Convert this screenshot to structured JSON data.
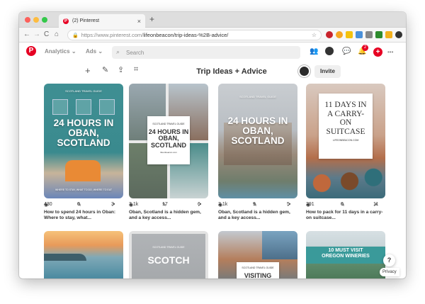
{
  "browser": {
    "tab_title": "(2) Pinterest",
    "tab_favicon": "P",
    "tab_close": "×",
    "new_tab": "+",
    "url_host": "https://www.pinterest.com/",
    "url_path": "lifeonbeacon/trip-ideas-%2B-advice/",
    "nav_icons": {
      "back": "←",
      "forward": "→",
      "reload": "C",
      "home": "⌂",
      "lock": "🔒",
      "star": "☆"
    }
  },
  "header": {
    "logo": "P",
    "analytics_label": "Analytics",
    "ads_label": "Ads",
    "chevron": "⌄",
    "search_placeholder": "Search",
    "notification_count": "2",
    "add": "+",
    "more": "•••"
  },
  "board": {
    "title": "Trip Ideas + Advice",
    "invite_label": "Invite",
    "tools": {
      "add": "+",
      "edit": "✎",
      "share": "⇪",
      "organize": "⌗"
    }
  },
  "pins": [
    {
      "title_lines": [
        "24 HOURS IN",
        "OBAN,",
        "SCOTLAND"
      ],
      "small_label": "SCOTLAND TRAVEL GUIDE",
      "footer": "WHERE TO STAY, WHAT TO DO, WHERE TO EAT",
      "saves": "430",
      "repins": "0",
      "clicks": "3",
      "description": "How to spend 24 hours in Oban: Where to stay, what..."
    },
    {
      "title_lines": [
        "24 HOURS IN",
        "OBAN,",
        "SCOTLAND"
      ],
      "small_label": "SCOTLAND TRAVEL GUIDE",
      "footer": "lifeonbeacon.com",
      "saves": "3.1k",
      "repins": "17",
      "clicks": "6",
      "description": "Oban, Scotland is a hidden gem, and a key access..."
    },
    {
      "title_lines": [
        "24 HOURS IN",
        "OBAN,",
        "SCOTLAND"
      ],
      "small_label": "SCOTLAND TRAVEL GUIDE",
      "footer": "",
      "saves": "2.1k",
      "repins": "9",
      "clicks": "5",
      "description": "Oban, Scotland is a hidden gem, and a key access..."
    },
    {
      "title_lines": [
        "11 DAYS IN",
        "A CARRY-",
        "ON",
        "SUITCASE"
      ],
      "small_label": "",
      "footer": "LIFEONBEACON.COM",
      "saves": "291",
      "repins": "0",
      "clicks": "11",
      "description": "How to pack for 11 days in a carry-on suitcase..."
    }
  ],
  "row2": {
    "pin2_label": "SCOTLAND TRAVEL GUIDE",
    "pin2_title": "SCOTCH",
    "pin3_label": "SCOTLAND TRAVEL GUIDE",
    "pin3_title": "VISITING",
    "pin4_title_lines": [
      "10 MUST VISIT",
      "OREGON WINERIES"
    ]
  },
  "stat_icons": {
    "eye": "◉",
    "pin": "✎",
    "arrow": "↗"
  },
  "help_label": "?",
  "privacy_label": "Privacy",
  "colors": {
    "pinterest_red": "#e60023",
    "teal": "#3a9a9a"
  }
}
